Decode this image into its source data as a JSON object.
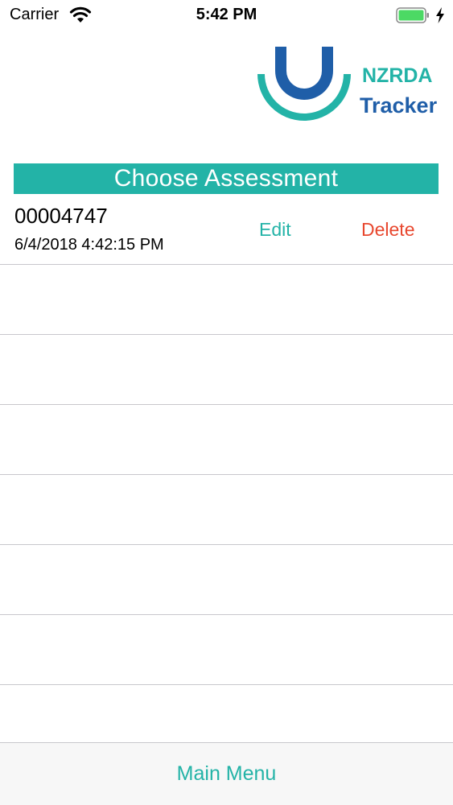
{
  "status_bar": {
    "carrier": "Carrier",
    "time": "5:42 PM",
    "icons": [
      "wifi-icon",
      "battery-icon",
      "charging-bolt-icon"
    ],
    "battery_color": "#4cd964"
  },
  "logo": {
    "line1": "NZRDA",
    "line2": "Tracker",
    "colors": {
      "teal": "#23b3a7",
      "blue": "#1f5ea8"
    }
  },
  "header": {
    "title": "Choose Assessment",
    "color": "#23b3a7"
  },
  "assessments": [
    {
      "id": "00004747",
      "date": "6/4/2018 4:42:15 PM",
      "edit_label": "Edit",
      "delete_label": "Delete"
    }
  ],
  "bottom_bar": {
    "main_menu_label": "Main Menu"
  },
  "colors": {
    "accent": "#23b3a7",
    "delete": "#e8472e",
    "separator": "#c8c7cc"
  }
}
